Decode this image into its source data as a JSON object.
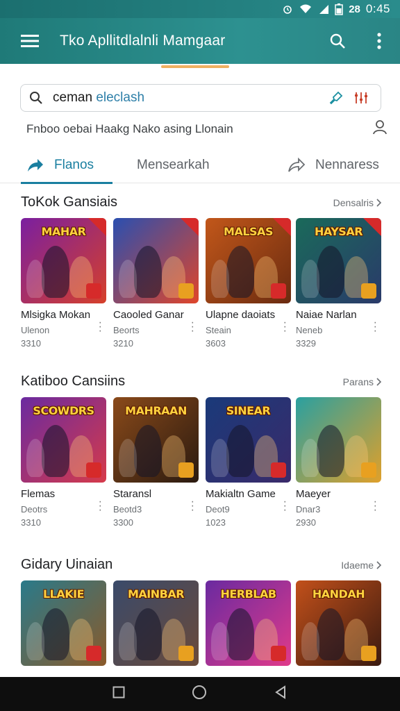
{
  "status_bar": {
    "time": "0:45",
    "battery_text": "28"
  },
  "app_bar": {
    "title": "Tko Apllitdlalnli Mamgaar"
  },
  "search": {
    "value_prefix": "ceman ",
    "value_highlight": "eleclash"
  },
  "subline": {
    "text": "Fnboo oebai Haakg Nako asing Llonain"
  },
  "tabs": [
    {
      "label": "Flanos",
      "active": true
    },
    {
      "label": "Mensearkah",
      "active": false
    },
    {
      "label": "Nennaress",
      "active": false
    }
  ],
  "sections": [
    {
      "title": "ToKok Gansiais",
      "more": "Densalris",
      "cards": [
        {
          "name": "Mlsigka Mokan",
          "sub": "Ulenon",
          "count": "3310",
          "art": "MAHAR",
          "bg": [
            "#7a1fa0",
            "#d6402a"
          ]
        },
        {
          "name": "Caooled Ganar",
          "sub": "Beorts",
          "count": "3210",
          "art": "",
          "bg": [
            "#2a4fb0",
            "#e0452a"
          ]
        },
        {
          "name": "Ulapne daoiats",
          "sub": "Steain",
          "count": "3603",
          "art": "MALSAS",
          "bg": [
            "#c2571a",
            "#6a2b10"
          ]
        },
        {
          "name": "Naiae Narlan",
          "sub": "Neneb",
          "count": "3329",
          "art": "HAYSAR",
          "bg": [
            "#1a6a5a",
            "#2a3a6a"
          ]
        }
      ]
    },
    {
      "title": "Katiboo Cansiins",
      "more": "Parans",
      "cards": [
        {
          "name": "Flemas",
          "sub": "Deotrs",
          "count": "3310",
          "art": "SCOWDRS",
          "bg": [
            "#6a2aa0",
            "#d63a4a"
          ]
        },
        {
          "name": "Staransl",
          "sub": "Beotd3",
          "count": "3300",
          "art": "MAHRAAN",
          "bg": [
            "#8a4a1a",
            "#2a1a10"
          ]
        },
        {
          "name": "Makialtn Game",
          "sub": "Deot9",
          "count": "1023",
          "art": "SINEAR",
          "bg": [
            "#1a3a7a",
            "#3a2a6a"
          ]
        },
        {
          "name": "Maeyer",
          "sub": "Dnar3",
          "count": "2930",
          "art": "",
          "bg": [
            "#2aa0a0",
            "#e0a02a"
          ]
        }
      ]
    },
    {
      "title": "Gidary Uinaian",
      "more": "Idaeme",
      "cards": [
        {
          "name": "",
          "sub": "",
          "count": "",
          "art": "LLAKIE",
          "bg": [
            "#2a7a8a",
            "#8a5a2a"
          ]
        },
        {
          "name": "",
          "sub": "",
          "count": "",
          "art": "MAINBAR",
          "bg": [
            "#3a4a6a",
            "#6a4a3a"
          ]
        },
        {
          "name": "",
          "sub": "",
          "count": "",
          "art": "HERBLAB",
          "bg": [
            "#6a2aa0",
            "#e03a8a"
          ]
        },
        {
          "name": "",
          "sub": "",
          "count": "",
          "art": "HANDAH",
          "bg": [
            "#c2501a",
            "#3a1a10"
          ]
        }
      ]
    }
  ],
  "colors": {
    "accent": "#1a7fa0",
    "appbar": "#2a8c8c"
  }
}
